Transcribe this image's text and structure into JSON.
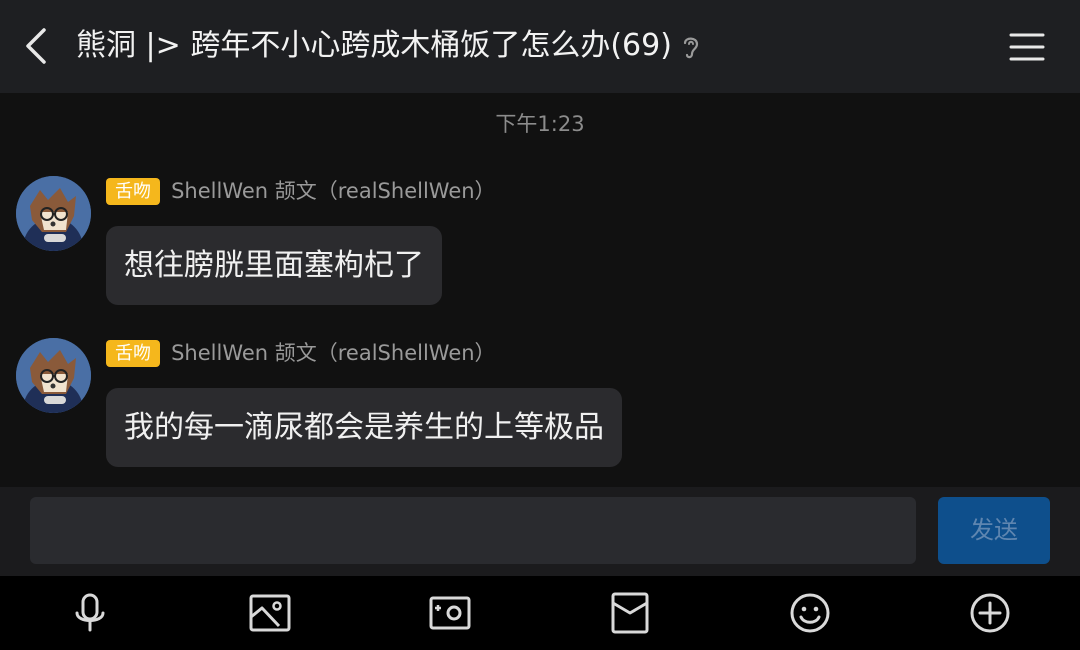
{
  "header": {
    "title": "熊洞 |> 跨年不小心跨成木桶饭了怎么办(69)",
    "back_icon": "chevron-left-icon",
    "ear_icon": "ear-icon",
    "menu_icon": "hamburger-menu-icon"
  },
  "timestamp": "下午1:23",
  "messages": [
    {
      "badge": "舌吻",
      "sender": "ShellWen 颉文（realShellWen）",
      "text": "想往膀胱里面塞枸杞了"
    },
    {
      "badge": "舌吻",
      "sender": "ShellWen 颉文（realShellWen）",
      "text": "我的每一滴尿都会是养生的上等极品"
    }
  ],
  "input": {
    "value": "",
    "placeholder": ""
  },
  "send_label": "发送",
  "toolbar": [
    "microphone-icon",
    "image-icon",
    "camera-icon",
    "red-packet-icon",
    "emoji-icon",
    "plus-icon"
  ],
  "colors": {
    "badge": "#f5b71c",
    "send_button": "#0e4f8c",
    "bubble": "#2b2b2e",
    "header": "#1e1f22"
  }
}
